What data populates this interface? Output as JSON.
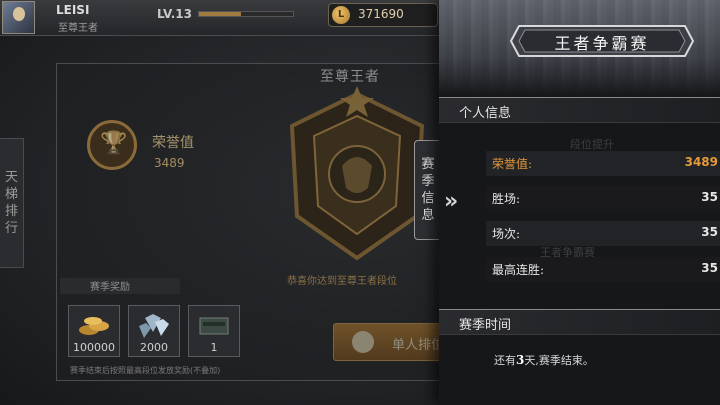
{
  "player": {
    "name": "LEISI",
    "title": "至尊王者",
    "level": "LV.13",
    "level_progress": 0.45
  },
  "currency": {
    "coins": "371690",
    "coin_symbol": "L"
  },
  "left_tab": {
    "chars": [
      "天",
      "梯",
      "排",
      "行"
    ]
  },
  "season_tab": {
    "chars": [
      "赛",
      "季",
      "信",
      "息"
    ]
  },
  "honor": {
    "label": "荣誉值",
    "value": "3489"
  },
  "rank": {
    "name": "至尊王者",
    "promo_text": "恭喜你达到至尊王者段位"
  },
  "rewards": {
    "header": "赛季奖励",
    "items": [
      {
        "value": "100000",
        "icon": "coin-pile-icon"
      },
      {
        "value": "2000",
        "icon": "diamond-icon"
      },
      {
        "value": "1",
        "icon": "weapon-crate-icon"
      }
    ],
    "note": "赛季结束后按照最高段位发放奖励(不叠加)"
  },
  "single_match_button": "单人排位",
  "panel": {
    "title": "王者争霸赛",
    "personal_header": "个人信息",
    "stats": [
      {
        "label": "荣誉值:",
        "value": "3489",
        "highlight": true
      },
      {
        "label": "胜场:",
        "value": "35",
        "highlight": false
      },
      {
        "label": "场次:",
        "value": "35",
        "highlight": false
      },
      {
        "label": "最高连胜:",
        "value": "35",
        "highlight": false
      }
    ],
    "season_header": "赛季时间",
    "season_note_prefix": "还有",
    "season_days": "3",
    "season_note_suffix": "天,赛季结束。"
  },
  "colors": {
    "accent": "#e49a3a",
    "gold": "#a07a3e",
    "panel_bg": "#161719"
  }
}
